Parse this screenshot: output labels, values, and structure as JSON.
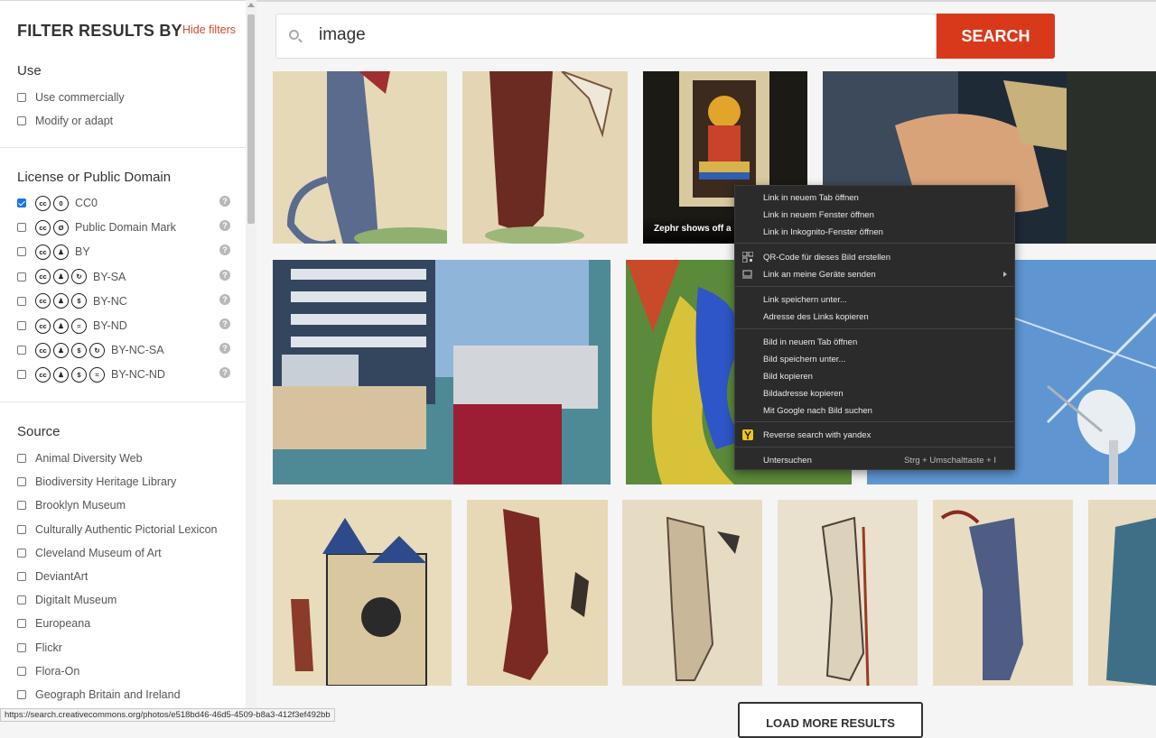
{
  "filters": {
    "heading": "FILTER RESULTS BY",
    "hide_label": "Hide filters",
    "use": {
      "title": "Use",
      "items": [
        {
          "label": "Use commercially",
          "checked": false
        },
        {
          "label": "Modify or adapt",
          "checked": false
        }
      ]
    },
    "license": {
      "title": "License or Public Domain",
      "items": [
        {
          "label": "CC0",
          "checked": true,
          "icons": [
            "cc-icon",
            "zero-icon"
          ]
        },
        {
          "label": "Public Domain Mark",
          "checked": false,
          "icons": [
            "cc-icon",
            "public-domain-icon"
          ]
        },
        {
          "label": "BY",
          "checked": false,
          "icons": [
            "cc-icon",
            "by-icon"
          ]
        },
        {
          "label": "BY-SA",
          "checked": false,
          "icons": [
            "cc-icon",
            "by-icon",
            "sa-icon"
          ]
        },
        {
          "label": "BY-NC",
          "checked": false,
          "icons": [
            "cc-icon",
            "by-icon",
            "nc-icon"
          ]
        },
        {
          "label": "BY-ND",
          "checked": false,
          "icons": [
            "cc-icon",
            "by-icon",
            "nd-icon"
          ]
        },
        {
          "label": "BY-NC-SA",
          "checked": false,
          "icons": [
            "cc-icon",
            "by-icon",
            "nc-icon",
            "sa-icon"
          ]
        },
        {
          "label": "BY-NC-ND",
          "checked": false,
          "icons": [
            "cc-icon",
            "by-icon",
            "nc-icon",
            "nd-icon"
          ]
        }
      ]
    },
    "source": {
      "title": "Source",
      "items": [
        {
          "label": "Animal Diversity Web",
          "checked": false
        },
        {
          "label": "Biodiversity Heritage Library",
          "checked": false
        },
        {
          "label": "Brooklyn Museum",
          "checked": false
        },
        {
          "label": "Culturally Authentic Pictorial Lexicon",
          "checked": false
        },
        {
          "label": "Cleveland Museum of Art",
          "checked": false
        },
        {
          "label": "DeviantArt",
          "checked": false
        },
        {
          "label": "DigitaIt Museum",
          "checked": false
        },
        {
          "label": "Europeana",
          "checked": false
        },
        {
          "label": "Flickr",
          "checked": false
        },
        {
          "label": "Flora-On",
          "checked": false
        },
        {
          "label": "Geograph Britain and Ireland",
          "checked": false
        }
      ]
    }
  },
  "search": {
    "value": "image",
    "button_label": "SEARCH"
  },
  "results": {
    "caption": "Zephr shows off a B",
    "load_more_label": "LOAD MORE RESULTS"
  },
  "context_menu": {
    "groups": [
      [
        {
          "label": "Link in neuem Tab öffnen"
        },
        {
          "label": "Link in neuem Fenster öffnen"
        },
        {
          "label": "Link in Inkognito-Fenster öffnen"
        }
      ],
      [
        {
          "label": "QR-Code für dieses Bild erstellen",
          "icon": "qr-code-icon"
        },
        {
          "label": "Link an meine Geräte senden",
          "icon": "devices-icon",
          "submenu": true
        }
      ],
      [
        {
          "label": "Link speichern unter..."
        },
        {
          "label": "Adresse des Links kopieren"
        }
      ],
      [
        {
          "label": "Bild in neuem Tab öffnen"
        },
        {
          "label": "Bild speichern unter..."
        },
        {
          "label": "Bild kopieren"
        },
        {
          "label": "Bildadresse kopieren"
        },
        {
          "label": "Mit Google nach Bild suchen"
        }
      ],
      [
        {
          "label": "Reverse search with yandex",
          "icon": "yandex-icon"
        }
      ],
      [
        {
          "label": "Untersuchen",
          "shortcut": "Strg + Umschalttaste + I"
        }
      ]
    ]
  },
  "status_bar": {
    "url": "https://search.creativecommons.org/photos/e518bd46-46d5-4509-b8a3-412f3ef492bb"
  },
  "colors": {
    "accent": "#d9391b",
    "checkbox_checked": "#1a73e8",
    "menu_bg": "#2b2b2b"
  }
}
